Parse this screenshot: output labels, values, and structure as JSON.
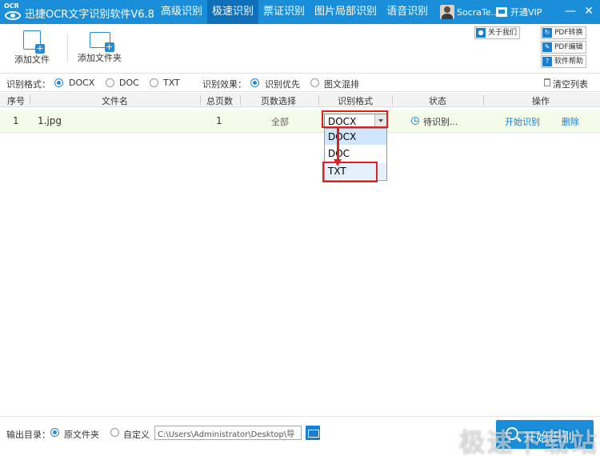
{
  "app": {
    "title": "迅捷OCR文字识别软件V6.8",
    "logo_text": "OCR"
  },
  "nav": {
    "tabs": [
      {
        "label": "高级识别",
        "active": false
      },
      {
        "label": "极速识别",
        "active": true
      },
      {
        "label": "票证识别",
        "active": false
      },
      {
        "label": "图片局部识别",
        "active": false
      },
      {
        "label": "语音识别",
        "active": false
      }
    ]
  },
  "user": {
    "name": "SocraTe..."
  },
  "vip": {
    "label": "开通VIP"
  },
  "window": {
    "minimize": "—",
    "close": "✕"
  },
  "toolbar": {
    "add_file": "添加文件",
    "add_folder": "添加文件夹",
    "about": "关于我们",
    "pdf_convert": "PDF转换",
    "pdf_edit": "PDF编辑",
    "help": "软件帮助"
  },
  "options": {
    "format_label": "识别格式：",
    "formats": [
      "DOCX",
      "DOC",
      "TXT"
    ],
    "selected_format": "DOCX",
    "effect_label": "识别效果：",
    "effects": [
      "识别优先",
      "图文混排"
    ],
    "selected_effect": "识别优先",
    "clear_list": "清空列表"
  },
  "table": {
    "headers": [
      "序号",
      "文件名",
      "总页数",
      "页数选择",
      "识别格式",
      "状态",
      "操作"
    ],
    "rows": [
      {
        "index": "1",
        "filename": "1.jpg",
        "pages": "1",
        "page_select": "全部",
        "format": "DOCX",
        "status": "待识别...",
        "action_start": "开始识别",
        "action_delete": "删除"
      }
    ]
  },
  "dropdown": {
    "options": [
      "DOCX",
      "DOC",
      "TXT"
    ],
    "highlighted": "DOCX",
    "target": "TXT"
  },
  "footer": {
    "output_label": "输出目录：",
    "original_folder": "原文件夹",
    "custom": "自定义",
    "path": "C:\\Users\\Administrator\\Desktop\\导",
    "start_label": "开始识别"
  },
  "watermark": "极速下载站",
  "colors": {
    "accent": "#1a8ed8",
    "active_tab": "#0f6fb8",
    "row_bg": "#f4fbe8",
    "highlight": "#e02020"
  }
}
